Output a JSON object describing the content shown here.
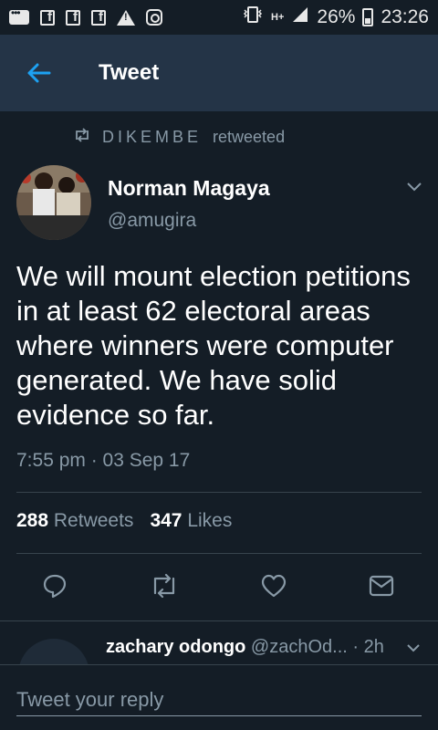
{
  "status_bar": {
    "battery": "26%",
    "time": "23:26",
    "network": "H+",
    "icons": [
      "message-icon",
      "facebook-icon",
      "facebook-icon",
      "facebook-icon",
      "warning-icon",
      "instagram-icon",
      "vibrate-icon",
      "signal-icon",
      "battery-icon"
    ]
  },
  "header": {
    "title": "Tweet",
    "back_icon": "arrow-left-icon"
  },
  "retweet": {
    "name": "DIKEMBE",
    "suffix": "retweeted"
  },
  "tweet": {
    "author_name": "Norman Magaya",
    "author_handle": "@amugira",
    "text": "We will mount election petitions in at least 62 electoral areas where winners were computer generated. We have solid evidence so far.",
    "timestamp": "7:55 pm · 03 Sep 17",
    "retweets_count": "288",
    "retweets_label": "Retweets",
    "likes_count": "347",
    "likes_label": "Likes"
  },
  "actions": [
    "reply-icon",
    "retweet-icon",
    "like-icon",
    "direct-message-icon"
  ],
  "reply_preview": {
    "name": "zachary odongo",
    "handle": "@zachOd...",
    "time": "· 2h"
  },
  "reply_bar": {
    "placeholder": "Tweet your reply"
  },
  "colors": {
    "background": "#141d26",
    "header": "#243447",
    "accent": "#1da1f2",
    "secondary_text": "#8899a6"
  }
}
